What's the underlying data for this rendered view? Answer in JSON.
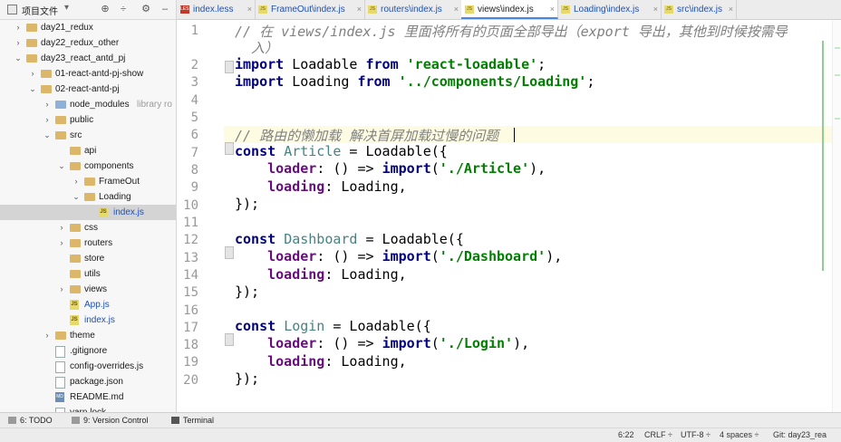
{
  "project_panel": {
    "title": "项目文件",
    "tree": [
      {
        "label": "day21_redux",
        "level": 1,
        "type": "folder",
        "arrow": "›"
      },
      {
        "label": "day22_redux_other",
        "level": 1,
        "type": "folder",
        "arrow": "›"
      },
      {
        "label": "day23_react_antd_pj",
        "level": 1,
        "type": "folder",
        "arrow": "⌄"
      },
      {
        "label": "01-react-antd-pj-show",
        "level": 2,
        "type": "folder",
        "arrow": "›"
      },
      {
        "label": "02-react-antd-pj",
        "level": 2,
        "type": "folder",
        "arrow": "⌄"
      },
      {
        "label": "node_modules",
        "suffix": "library ro",
        "level": 3,
        "type": "folder",
        "arrow": "›"
      },
      {
        "label": "public",
        "level": 3,
        "type": "folder",
        "arrow": "›"
      },
      {
        "label": "src",
        "level": 3,
        "type": "folder",
        "arrow": "⌄"
      },
      {
        "label": "api",
        "level": 4,
        "type": "folder",
        "arrow": ""
      },
      {
        "label": "components",
        "level": 4,
        "type": "folder",
        "arrow": "⌄"
      },
      {
        "label": "FrameOut",
        "level": 5,
        "type": "folder",
        "arrow": "›"
      },
      {
        "label": "Loading",
        "level": 5,
        "type": "folder",
        "arrow": "⌄"
      },
      {
        "label": "index.js",
        "level": 6,
        "type": "js",
        "arrow": "",
        "selected": true
      },
      {
        "label": "css",
        "level": 4,
        "type": "folder",
        "arrow": "›"
      },
      {
        "label": "routers",
        "level": 4,
        "type": "folder",
        "arrow": "›"
      },
      {
        "label": "store",
        "level": 4,
        "type": "folder",
        "arrow": ""
      },
      {
        "label": "utils",
        "level": 4,
        "type": "folder",
        "arrow": ""
      },
      {
        "label": "views",
        "level": 4,
        "type": "folder",
        "arrow": "›"
      },
      {
        "label": "App.js",
        "level": 4,
        "type": "js",
        "arrow": ""
      },
      {
        "label": "index.js",
        "level": 4,
        "type": "js",
        "arrow": ""
      },
      {
        "label": "theme",
        "level": 3,
        "type": "folder",
        "arrow": "›"
      },
      {
        "label": ".gitignore",
        "level": 3,
        "type": "file",
        "arrow": ""
      },
      {
        "label": "config-overrides.js",
        "level": 3,
        "type": "file",
        "arrow": ""
      },
      {
        "label": "package.json",
        "level": 3,
        "type": "file",
        "arrow": ""
      },
      {
        "label": "README.md",
        "level": 3,
        "type": "md",
        "arrow": ""
      },
      {
        "label": "yarn.lock",
        "level": 3,
        "type": "file",
        "arrow": ""
      }
    ]
  },
  "tabs": [
    {
      "label": "index.less",
      "icon": "less",
      "active": false
    },
    {
      "label": "FrameOut\\index.js",
      "icon": "js",
      "active": false
    },
    {
      "label": "routers\\index.js",
      "icon": "js",
      "active": false
    },
    {
      "label": "views\\index.js",
      "icon": "js",
      "active": true
    },
    {
      "label": "Loading\\index.js",
      "icon": "js",
      "active": false
    },
    {
      "label": "src\\index.js",
      "icon": "js",
      "active": false
    }
  ],
  "editor": {
    "line_numbers": [
      "1",
      "",
      "2",
      "3",
      "4",
      "5",
      "6",
      "7",
      "8",
      "9",
      "10",
      "11",
      "12",
      "13",
      "14",
      "15",
      "16",
      "17",
      "18",
      "19",
      "20"
    ],
    "comment_line1": "// 在 views/index.js 里面将所有的页面全部导出（export 导出，其他到时候按需导",
    "comment_line1b": "  入）",
    "import1": {
      "kw": "import",
      "name": " Loadable ",
      "from": "from",
      "str": "'react-loadable'",
      "end": ";"
    },
    "import2": {
      "kw": "import",
      "name": " Loading ",
      "from": "from",
      "str": "'../components/Loading'",
      "end": ";"
    },
    "comment_line6": "// 路由的懒加载 解决首屏加载过慢的问题",
    "blocks": [
      {
        "name": "Article",
        "path": "'./Article'"
      },
      {
        "name": "Dashboard",
        "path": "'./Dashboard'"
      },
      {
        "name": "Login",
        "path": "'./Login'"
      }
    ],
    "const_kw": "const",
    "eq": " = Loadable({",
    "loader_key": "loader",
    "loader_mid": ": () => ",
    "import_kw": "import",
    "loading_key": "loading",
    "loading_val": ": Loading,",
    "close": "});"
  },
  "toolwindows": {
    "todo": "6: TODO",
    "version_control": "9: Version Control",
    "terminal": "Terminal"
  },
  "status_bar": {
    "position": "6:22",
    "line_sep": "CRLF ÷",
    "encoding": "UTF-8 ÷",
    "indent": "4 spaces ÷",
    "git": "Git: day23_rea"
  },
  "colors": {
    "keyword": "#000080",
    "string": "#008000",
    "property": "#660e7a",
    "comment": "#808080",
    "link": "#1e50b4"
  }
}
